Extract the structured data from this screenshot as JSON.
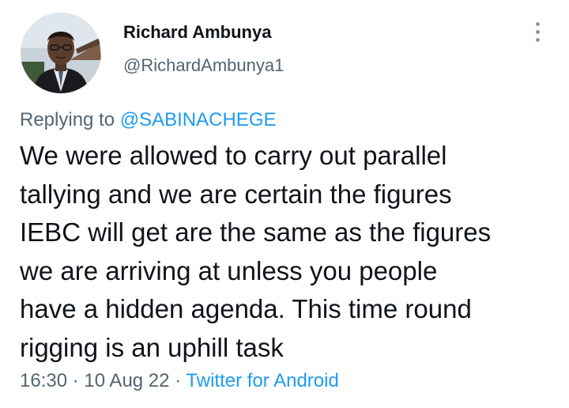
{
  "author": {
    "display_name": "Richard Ambunya",
    "handle": "@RichardAmbunya1",
    "avatar_icon": "profile-photo"
  },
  "menu": {
    "icon": "more-vertical-icon"
  },
  "reply": {
    "prefix": "Replying to ",
    "mention": "@SABINACHEGE"
  },
  "tweet_lines": [
    "We were allowed to carry out parallel",
    "tallying and we are certain the figures",
    "IEBC will get are the same as the figures",
    "we are arriving at unless you people",
    "have a hidden agenda. This time round",
    "rigging is an uphill task"
  ],
  "meta": {
    "time": "16:30",
    "sep1": " · ",
    "date": "10 Aug 22",
    "sep2": " · ",
    "source": "Twitter for Android"
  },
  "colors": {
    "text": "#0f1419",
    "secondary": "#536471",
    "link": "#1d9bf0"
  }
}
